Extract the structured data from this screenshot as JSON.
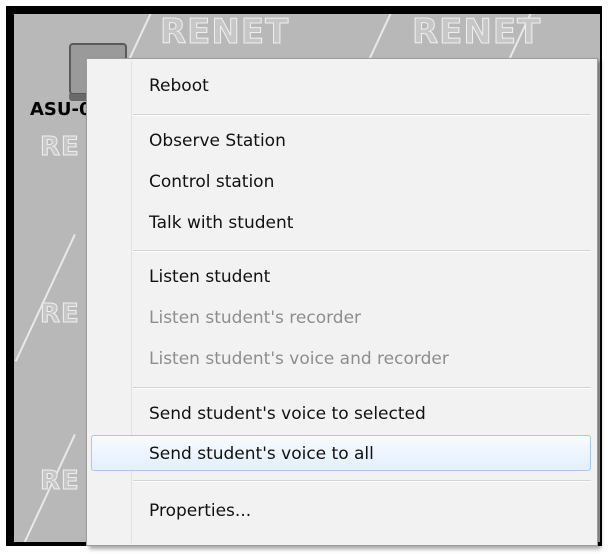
{
  "background": {
    "watermarks": [
      "RENET",
      "RENET",
      "RE",
      "RE",
      "RE"
    ],
    "station": {
      "label": "ASU-0"
    }
  },
  "context_menu": {
    "items": [
      {
        "label": "Reboot",
        "enabled": true
      },
      {
        "label": "Observe Station",
        "enabled": true
      },
      {
        "label": "Control station",
        "enabled": true
      },
      {
        "label": "Talk with student",
        "enabled": true
      },
      {
        "label": "Listen student",
        "enabled": true
      },
      {
        "label": "Listen student's recorder",
        "enabled": false
      },
      {
        "label": "Listen student's voice and recorder",
        "enabled": false
      },
      {
        "label": "Send student's voice to selected",
        "enabled": true
      },
      {
        "label": "Send student's voice to all",
        "enabled": true,
        "hovered": true
      },
      {
        "label": "Properties...",
        "enabled": true
      }
    ]
  },
  "colors": {
    "menu_background": "#f2f2f2",
    "disabled_text": "#8d8d8d",
    "hover_border": "#a9c8ee"
  }
}
